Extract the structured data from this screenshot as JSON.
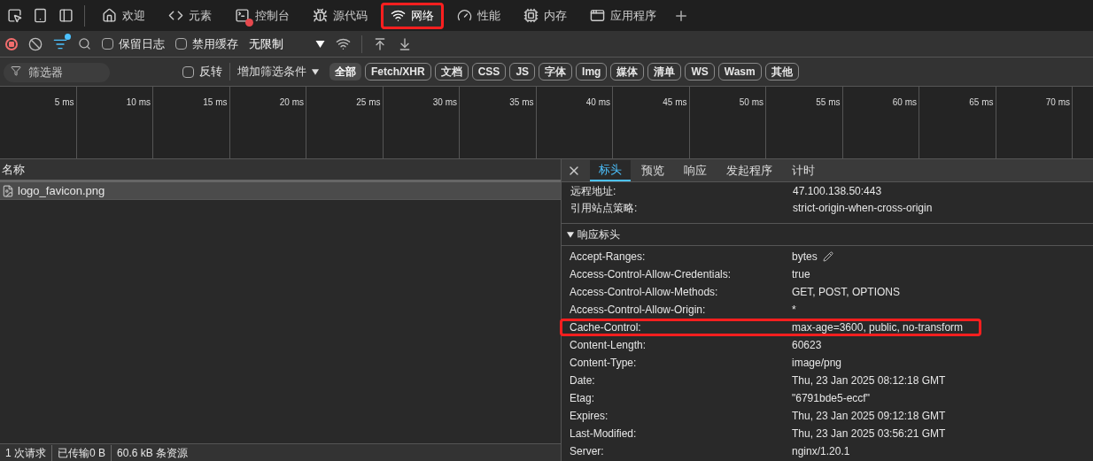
{
  "main_tabs": [
    {
      "label": "欢迎",
      "selected": false,
      "highlighted": false,
      "error": false
    },
    {
      "label": "元素",
      "selected": false,
      "highlighted": false,
      "error": false
    },
    {
      "label": "控制台",
      "selected": false,
      "highlighted": false,
      "error": true
    },
    {
      "label": "源代码",
      "selected": false,
      "highlighted": false,
      "error": false
    },
    {
      "label": "网络",
      "selected": true,
      "highlighted": true,
      "error": false
    },
    {
      "label": "性能",
      "selected": false,
      "highlighted": false,
      "error": false
    },
    {
      "label": "内存",
      "selected": false,
      "highlighted": false,
      "error": false
    },
    {
      "label": "应用程序",
      "selected": false,
      "highlighted": false,
      "error": false
    }
  ],
  "toolbar": {
    "recording": true,
    "filter_active": true,
    "preserve_log": {
      "label": "保留日志",
      "checked": false
    },
    "disable_cache": {
      "label": "禁用缓存",
      "checked": false
    },
    "throttling": "无限制"
  },
  "filter_bar": {
    "placeholder": "筛选器",
    "invert": {
      "label": "反转",
      "checked": false
    },
    "more_filters": "增加筛选条件",
    "types": [
      {
        "label": "全部",
        "selected": true
      },
      {
        "label": "Fetch/XHR",
        "selected": false
      },
      {
        "label": "文档",
        "selected": false
      },
      {
        "label": "CSS",
        "selected": false
      },
      {
        "label": "JS",
        "selected": false
      },
      {
        "label": "字体",
        "selected": false
      },
      {
        "label": "Img",
        "selected": false
      },
      {
        "label": "媒体",
        "selected": false
      },
      {
        "label": "清单",
        "selected": false
      },
      {
        "label": "WS",
        "selected": false
      },
      {
        "label": "Wasm",
        "selected": false
      },
      {
        "label": "其他",
        "selected": false
      }
    ]
  },
  "timeline": {
    "ticks": [
      "5 ms",
      "10 ms",
      "15 ms",
      "20 ms",
      "25 ms",
      "30 ms",
      "35 ms",
      "40 ms",
      "45 ms",
      "50 ms",
      "55 ms",
      "60 ms",
      "65 ms",
      "70 ms"
    ]
  },
  "requests": {
    "column": "名称",
    "rows": [
      {
        "name": "logo_favicon.png",
        "selected": true
      }
    ]
  },
  "status_bar": [
    "1 次请求",
    "已传输0 B",
    "60.6 kB 条资源"
  ],
  "details": {
    "tabs": [
      {
        "label": "标头",
        "selected": true
      },
      {
        "label": "预览",
        "selected": false
      },
      {
        "label": "响应",
        "selected": false
      },
      {
        "label": "发起程序",
        "selected": false
      },
      {
        "label": "计时",
        "selected": false
      }
    ],
    "general_rows": [
      {
        "name": "远程地址:",
        "value": "47.100.138.50:443"
      },
      {
        "name": "引用站点策略:",
        "value": "strict-origin-when-cross-origin"
      }
    ],
    "section": {
      "title": "响应标头",
      "expanded": true
    },
    "headers": [
      {
        "name": "Accept-Ranges:",
        "value": "bytes",
        "editable": true,
        "highlighted": false
      },
      {
        "name": "Access-Control-Allow-Credentials:",
        "value": "true",
        "editable": false,
        "highlighted": false
      },
      {
        "name": "Access-Control-Allow-Methods:",
        "value": "GET, POST, OPTIONS",
        "editable": false,
        "highlighted": false
      },
      {
        "name": "Access-Control-Allow-Origin:",
        "value": "*",
        "editable": false,
        "highlighted": false
      },
      {
        "name": "Cache-Control:",
        "value": "max-age=3600, public, no-transform",
        "editable": false,
        "highlighted": true
      },
      {
        "name": "Content-Length:",
        "value": "60623",
        "editable": false,
        "highlighted": false
      },
      {
        "name": "Content-Type:",
        "value": "image/png",
        "editable": false,
        "highlighted": false
      },
      {
        "name": "Date:",
        "value": "Thu, 23 Jan 2025 08:12:18 GMT",
        "editable": false,
        "highlighted": false
      },
      {
        "name": "Etag:",
        "value": "\"6791bde5-eccf\"",
        "editable": false,
        "highlighted": false
      },
      {
        "name": "Expires:",
        "value": "Thu, 23 Jan 2025 09:12:18 GMT",
        "editable": false,
        "highlighted": false
      },
      {
        "name": "Last-Modified:",
        "value": "Thu, 23 Jan 2025 03:56:21 GMT",
        "editable": false,
        "highlighted": false
      },
      {
        "name": "Server:",
        "value": "nginx/1.20.1",
        "editable": false,
        "highlighted": false
      }
    ]
  }
}
